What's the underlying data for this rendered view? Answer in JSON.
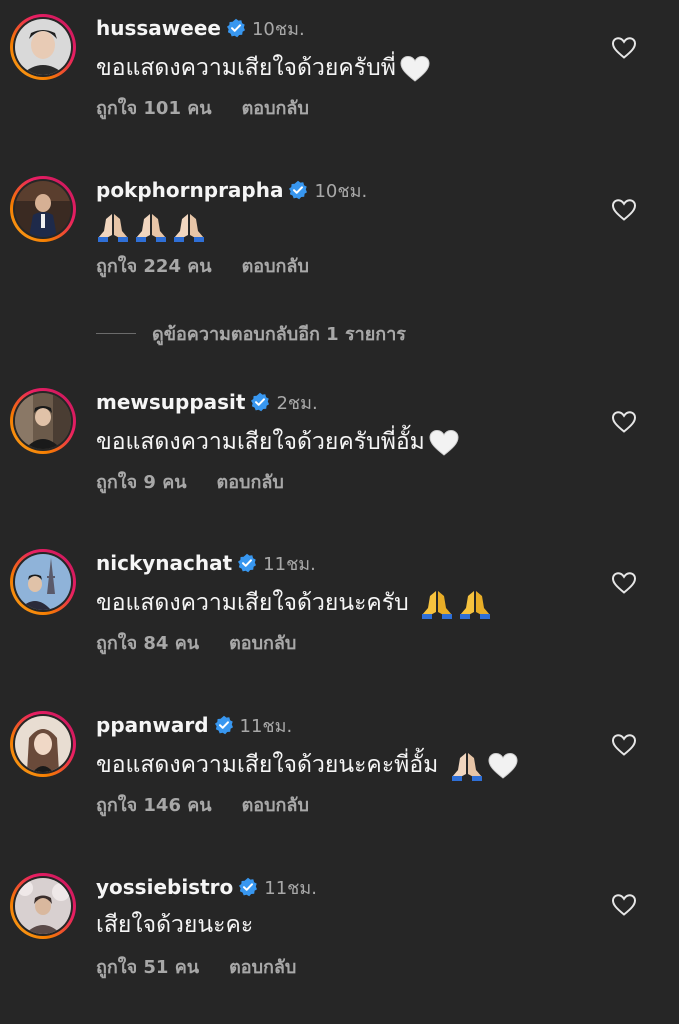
{
  "comments": [
    {
      "username": "hussaweee",
      "time": "10ชม.",
      "text": "ขอแสดงความเสียใจด้วยครับพี่",
      "likes": "ถูกใจ 101 คน",
      "reply": "ตอบกลับ",
      "emojis": [
        "white-heart"
      ],
      "avatar_colors": [
        "#cfcfcf",
        "#2b2b2b"
      ]
    },
    {
      "username": "pokphornprapha",
      "time": "10ชม.",
      "text": "",
      "likes": "ถูกใจ 224 คน",
      "reply": "ตอบกลับ",
      "emojis": [
        "folded-hands-light",
        "folded-hands-light",
        "folded-hands-light"
      ],
      "avatar_colors": [
        "#3a2a22",
        "#1e2a4a"
      ]
    },
    {
      "username": "mewsuppasit",
      "time": "2ชม.",
      "text": "ขอแสดงความเสียใจด้วยครับพี่อั้ม",
      "likes": "ถูกใจ 9 คน",
      "reply": "ตอบกลับ",
      "emojis": [
        "white-heart"
      ],
      "avatar_colors": [
        "#6b5a4a",
        "#1a1a1a"
      ]
    },
    {
      "username": "nickynachat",
      "time": "11ชม.",
      "text": "ขอแสดงความเสียใจด้วยนะครับ ",
      "likes": "ถูกใจ 84 คน",
      "reply": "ตอบกลับ",
      "emojis": [
        "folded-hands-yellow",
        "folded-hands-yellow"
      ],
      "avatar_colors": [
        "#8fb3d9",
        "#2a2a3a"
      ]
    },
    {
      "username": "ppanward",
      "time": "11ชม.",
      "text": "ขอแสดงความเสียใจด้วยนะคะพี่อั้ม ",
      "likes": "ถูกใจ 146 คน",
      "reply": "ตอบกลับ",
      "emojis": [
        "folded-hands-light",
        "white-heart"
      ],
      "avatar_colors": [
        "#e8ddd2",
        "#6a4a3a"
      ]
    },
    {
      "username": "yossiebistro",
      "time": "11ชม.",
      "text": "เสียใจด้วยนะคะ",
      "likes": "ถูกใจ 51 คน",
      "reply": "ตอบกลับ",
      "emojis": [],
      "avatar_colors": [
        "#d8d0d0",
        "#5a4a48"
      ]
    }
  ],
  "view_replies": "ดูข้อความตอบกลับอีก 1 รายการ",
  "colors": {
    "background": "#262626",
    "verified": "#3897f0",
    "secondary_text": "#a8a8a8",
    "primary_text": "#f5f5f5"
  },
  "icons": [
    "verified-badge-icon",
    "heart-outline-icon",
    "white-heart-emoji",
    "folded-hands-emoji"
  ]
}
